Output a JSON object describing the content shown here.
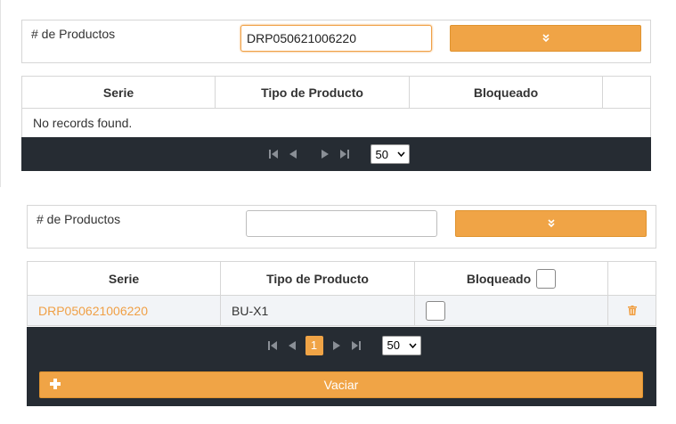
{
  "upper": {
    "label": "# de Productos",
    "input_value": "DRP050621006220",
    "search_icon": "double-chevron-down-icon",
    "columns": [
      "Serie",
      "Tipo de Producto",
      "Bloqueado",
      ""
    ],
    "empty_message": "No records found.",
    "rows_per_page": "50"
  },
  "lower": {
    "label": "# de Productos",
    "input_value": "",
    "search_icon": "double-chevron-down-icon",
    "columns": [
      "Serie",
      "Tipo de Producto",
      "Bloqueado",
      ""
    ],
    "rows": [
      {
        "serie": "DRP050621006220",
        "tipo": "BU-X1",
        "bloqueado": false
      }
    ],
    "current_page": "1",
    "rows_per_page": "50",
    "clear_button": "Vaciar",
    "clear_icon": "plus-icon",
    "delete_icon": "trash-icon"
  },
  "colors": {
    "accent": "#f0a446",
    "pager_bg": "#262c33",
    "link": "#f0a046"
  }
}
